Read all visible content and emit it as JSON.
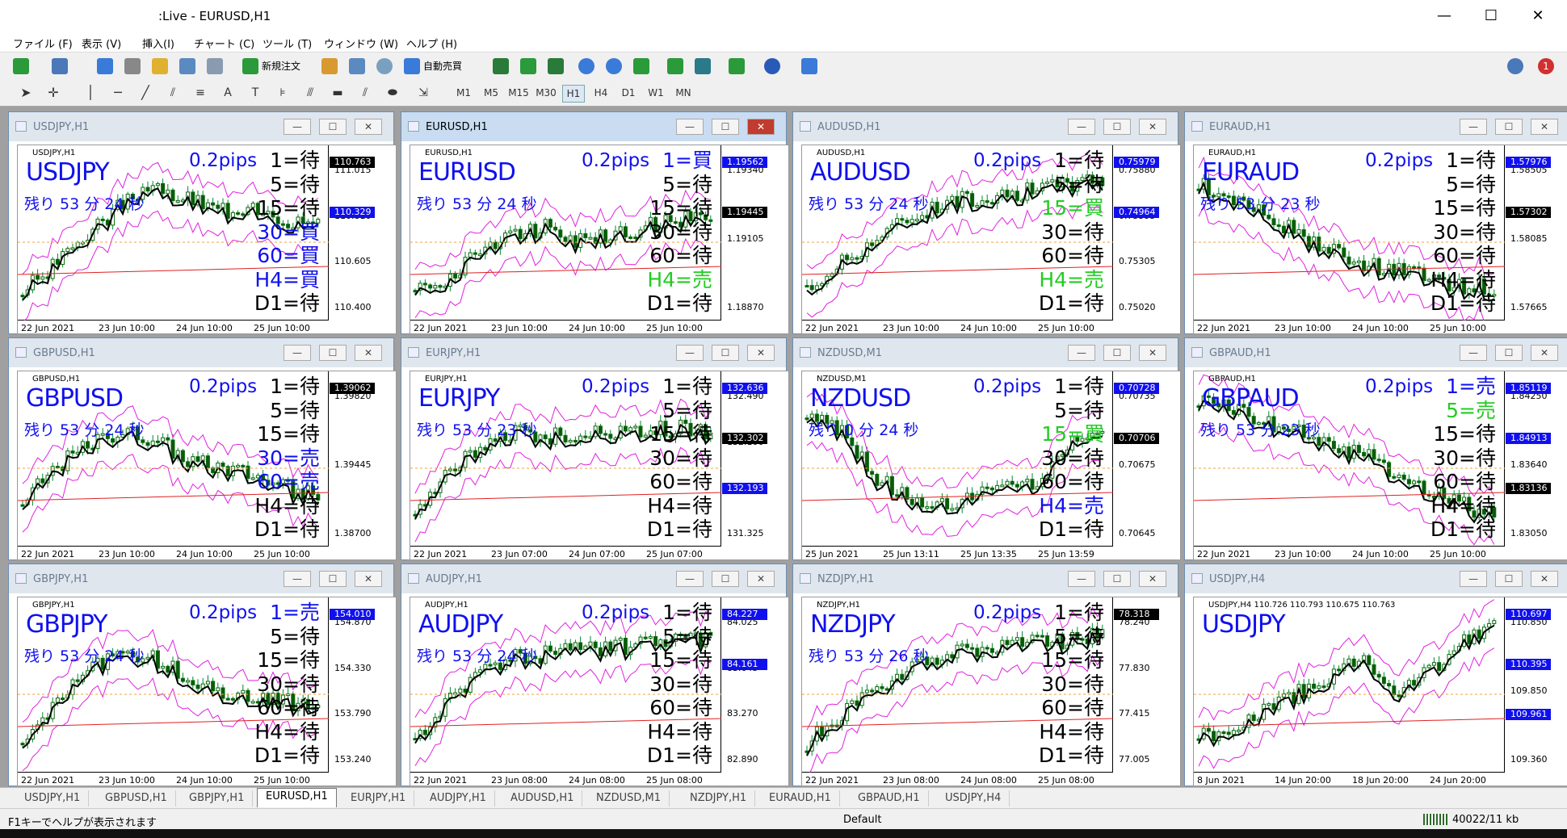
{
  "title": ":Live - EURUSD,H1",
  "menu": [
    "ファイル (F)",
    "表示 (V)",
    "挿入(I)",
    "チャート (C)",
    "ツール (T)",
    "ウィンドウ (W)",
    "ヘルプ (H)"
  ],
  "toolbar": {
    "new_order": "新規注文",
    "auto_trade": "自動売買"
  },
  "timeframes": [
    "M1",
    "M5",
    "M15",
    "M30",
    "H1",
    "H4",
    "D1",
    "W1",
    "MN"
  ],
  "notif_count": "1",
  "charts": [
    {
      "caption": "USDJPY,H1",
      "mini": "USDJPY,H1",
      "sym": "USDJPY",
      "pips": "0.2pips",
      "remain": "残り 53 分 24 秒",
      "sig": [
        "1=待",
        "5=待",
        "15=待",
        "30=買",
        "60=買",
        "H4=買",
        "D1=待"
      ],
      "sigc": [
        "k",
        "k",
        "k",
        "b",
        "b",
        "b",
        "k"
      ],
      "prices": [
        "111.015",
        "110.810",
        "110.605",
        "110.400"
      ],
      "tags": [
        {
          "t": "110.763",
          "c": "black"
        },
        {
          "t": "110.329",
          "c": "blue"
        }
      ],
      "xl": [
        "22 Jun 2021",
        "23 Jun 10:00",
        "24 Jun 10:00",
        "25 Jun 10:00"
      ],
      "trend": [
        0.1,
        0.3,
        0.5,
        0.7,
        0.8,
        0.75,
        0.65,
        0.7,
        0.6,
        0.55
      ]
    },
    {
      "caption": "EURUSD,H1",
      "mini": "EURUSD,H1",
      "sym": "EURUSD",
      "pips": "0.2pips",
      "remain": "残り 53 分 24 秒",
      "sig": [
        "1=買",
        "5=待",
        "15=待",
        "30=待",
        "60=待",
        "H4=売",
        "D1=待"
      ],
      "sigc": [
        "b",
        "k",
        "k",
        "k",
        "k",
        "g",
        "k"
      ],
      "prices": [
        "1.19340",
        "1.19105",
        "1.18870"
      ],
      "tags": [
        {
          "t": "1.19562",
          "c": "blue"
        },
        {
          "t": "1.19445",
          "c": "black"
        }
      ],
      "xl": [
        "22 Jun 2021",
        "23 Jun 10:00",
        "24 Jun 10:00",
        "25 Jun 10:00"
      ],
      "trend": [
        0.1,
        0.2,
        0.4,
        0.5,
        0.55,
        0.45,
        0.5,
        0.55,
        0.6,
        0.65
      ]
    },
    {
      "caption": "AUDUSD,H1",
      "mini": "AUDUSD,H1",
      "sym": "AUDUSD",
      "pips": "0.2pips",
      "remain": "残り 53 分 24 秒",
      "sig": [
        "1=待",
        "5=待",
        "15=買",
        "30=待",
        "60=待",
        "H4=売",
        "D1=待"
      ],
      "sigc": [
        "k",
        "k",
        "g",
        "k",
        "k",
        "g",
        "k"
      ],
      "prices": [
        "0.75880",
        "0.75595",
        "0.75305",
        "0.75020"
      ],
      "tags": [
        {
          "t": "0.75979",
          "c": "blue"
        },
        {
          "t": "0.74964",
          "c": "blue"
        }
      ],
      "xl": [
        "22 Jun 2021",
        "23 Jun 10:00",
        "24 Jun 10:00",
        "25 Jun 10:00"
      ],
      "trend": [
        0.1,
        0.3,
        0.45,
        0.6,
        0.7,
        0.75,
        0.78,
        0.8,
        0.85,
        0.88
      ]
    },
    {
      "caption": "EURAUD,H1",
      "mini": "EURAUD,H1",
      "sym": "EURAUD",
      "pips": "0.2pips",
      "remain": "残り 53 分 23 秒",
      "sig": [
        "1=待",
        "5=待",
        "15=待",
        "30=待",
        "60=待",
        "H4=待",
        "D1=待"
      ],
      "sigc": [
        "k",
        "k",
        "k",
        "k",
        "k",
        "k",
        "k"
      ],
      "prices": [
        "1.58505",
        "1.58085",
        "1.57665"
      ],
      "tags": [
        {
          "t": "1.57976",
          "c": "blue"
        },
        {
          "t": "1.57302",
          "c": "black"
        }
      ],
      "xl": [
        "22 Jun 2021",
        "23 Jun 10:00",
        "24 Jun 10:00",
        "25 Jun 10:00"
      ],
      "trend": [
        0.85,
        0.75,
        0.65,
        0.5,
        0.4,
        0.3,
        0.25,
        0.2,
        0.15,
        0.12
      ]
    },
    {
      "caption": "GBPUSD,H1",
      "mini": "GBPUSD,H1",
      "sym": "GBPUSD",
      "pips": "0.2pips",
      "remain": "残り 53 分 24 秒",
      "sig": [
        "1=待",
        "5=待",
        "15=待",
        "30=売",
        "60=売",
        "H4=待",
        "D1=待"
      ],
      "sigc": [
        "k",
        "k",
        "k",
        "b",
        "b",
        "k",
        "k"
      ],
      "prices": [
        "1.39820",
        "1.39445",
        "1.38700"
      ],
      "tags": [
        {
          "t": "1.39062",
          "c": "black"
        }
      ],
      "xl": [
        "22 Jun 2021",
        "23 Jun 10:00",
        "24 Jun 10:00",
        "25 Jun 10:00"
      ],
      "trend": [
        0.2,
        0.45,
        0.6,
        0.7,
        0.65,
        0.5,
        0.45,
        0.4,
        0.3,
        0.25
      ]
    },
    {
      "caption": "EURJPY,H1",
      "mini": "EURJPY,H1",
      "sym": "EURJPY",
      "pips": "0.2pips",
      "remain": "残り 53 分 23 秒",
      "sig": [
        "1=待",
        "5=待",
        "15=待",
        "30=待",
        "60=待",
        "H4=待",
        "D1=待"
      ],
      "sigc": [
        "k",
        "k",
        "k",
        "k",
        "k",
        "k",
        "k"
      ],
      "prices": [
        "132.490",
        "132.100",
        "131.715",
        "131.325"
      ],
      "tags": [
        {
          "t": "132.636",
          "c": "blue"
        },
        {
          "t": "132.302",
          "c": "black"
        },
        {
          "t": "132.193",
          "c": "blue"
        }
      ],
      "xl": [
        "22 Jun 2021",
        "23 Jun 07:00",
        "24 Jun 07:00",
        "25 Jun 07:00"
      ],
      "trend": [
        0.1,
        0.4,
        0.6,
        0.7,
        0.65,
        0.7,
        0.68,
        0.7,
        0.72,
        0.7
      ]
    },
    {
      "caption": "NZDUSD,M1",
      "mini": "NZDUSD,M1",
      "sym": "NZDUSD",
      "pips": "0.2pips",
      "remain": "残り 0 分 24 秒",
      "sig": [
        "1=待",
        "5=待",
        "15=買",
        "30=待",
        "60=待",
        "H4=売",
        "D1=待"
      ],
      "sigc": [
        "k",
        "k",
        "g",
        "k",
        "k",
        "b",
        "k"
      ],
      "prices": [
        "0.70735",
        "0.70675",
        "0.70645"
      ],
      "tags": [
        {
          "t": "0.70728",
          "c": "blue"
        },
        {
          "t": "0.70706",
          "c": "black"
        }
      ],
      "xl": [
        "25 Jun 2021",
        "25 Jun 13:11",
        "25 Jun 13:35",
        "25 Jun 13:59"
      ],
      "trend": [
        0.85,
        0.7,
        0.4,
        0.25,
        0.2,
        0.25,
        0.3,
        0.35,
        0.6,
        0.7
      ]
    },
    {
      "caption": "GBPAUD,H1",
      "mini": "GBPAUD,H1",
      "sym": "GBPAUD",
      "pips": "0.2pips",
      "remain": "残り 53 分 23 秒",
      "sig": [
        "1=売",
        "5=売",
        "15=待",
        "30=待",
        "60=待",
        "H4=待",
        "D1=待"
      ],
      "sigc": [
        "b",
        "g",
        "k",
        "k",
        "k",
        "k",
        "k"
      ],
      "prices": [
        "1.84250",
        "1.83640",
        "1.83050"
      ],
      "tags": [
        {
          "t": "1.85119",
          "c": "blue"
        },
        {
          "t": "1.84913",
          "c": "blue"
        },
        {
          "t": "1.83136",
          "c": "black"
        }
      ],
      "xl": [
        "22 Jun 2021",
        "23 Jun 10:00",
        "24 Jun 10:00",
        "25 Jun 10:00"
      ],
      "trend": [
        0.9,
        0.85,
        0.75,
        0.7,
        0.6,
        0.55,
        0.4,
        0.3,
        0.2,
        0.1
      ]
    },
    {
      "caption": "GBPJPY,H1",
      "mini": "GBPJPY,H1",
      "sym": "GBPJPY",
      "pips": "0.2pips",
      "remain": "残り 53 分 24 秒",
      "sig": [
        "1=売",
        "5=待",
        "15=待",
        "30=待",
        "60=待",
        "H4=待",
        "D1=待"
      ],
      "sigc": [
        "b",
        "k",
        "k",
        "k",
        "k",
        "k",
        "k"
      ],
      "prices": [
        "154.870",
        "154.330",
        "153.790",
        "153.240"
      ],
      "tags": [
        {
          "t": "154.010",
          "c": "blue"
        }
      ],
      "xl": [
        "22 Jun 2021",
        "23 Jun 10:00",
        "24 Jun 10:00",
        "25 Jun 10:00"
      ],
      "trend": [
        0.1,
        0.4,
        0.6,
        0.75,
        0.7,
        0.55,
        0.45,
        0.45,
        0.4,
        0.35
      ]
    },
    {
      "caption": "AUDJPY,H1",
      "mini": "AUDJPY,H1",
      "sym": "AUDJPY",
      "pips": "0.2pips",
      "remain": "残り 53 分 24 秒",
      "sig": [
        "1=待",
        "5=待",
        "15=待",
        "30=待",
        "60=待",
        "H4=待",
        "D1=待"
      ],
      "sigc": [
        "k",
        "k",
        "k",
        "k",
        "k",
        "k",
        "k"
      ],
      "prices": [
        "84.025",
        "83.645",
        "83.270",
        "82.890"
      ],
      "tags": [
        {
          "t": "84.227",
          "c": "blue"
        },
        {
          "t": "84.161",
          "c": "blue"
        }
      ],
      "xl": [
        "22 Jun 2021",
        "23 Jun 08:00",
        "24 Jun 08:00",
        "25 Jun 08:00"
      ],
      "trend": [
        0.1,
        0.4,
        0.6,
        0.7,
        0.72,
        0.75,
        0.77,
        0.78,
        0.8,
        0.82
      ]
    },
    {
      "caption": "NZDJPY,H1",
      "mini": "NZDJPY,H1",
      "sym": "NZDJPY",
      "pips": "0.2pips",
      "remain": "残り 53 分 26 秒",
      "sig": [
        "1=待",
        "5=待",
        "15=待",
        "30=待",
        "60=待",
        "H4=待",
        "D1=待"
      ],
      "sigc": [
        "k",
        "k",
        "k",
        "k",
        "k",
        "k",
        "k"
      ],
      "prices": [
        "78.240",
        "77.830",
        "77.415",
        "77.005"
      ],
      "tags": [
        {
          "t": "78.318",
          "c": "black"
        }
      ],
      "xl": [
        "22 Jun 2021",
        "23 Jun 08:00",
        "24 Jun 08:00",
        "25 Jun 08:00"
      ],
      "trend": [
        0.1,
        0.3,
        0.45,
        0.6,
        0.7,
        0.75,
        0.78,
        0.8,
        0.82,
        0.85
      ]
    },
    {
      "caption": "USDJPY,H4",
      "mini": "USDJPY,H4  110.726 110.793 110.675 110.763",
      "sym": "USDJPY",
      "pips": "",
      "remain": "",
      "sig": [],
      "sigc": [],
      "prices": [
        "110.850",
        "109.850",
        "109.360"
      ],
      "tags": [
        {
          "t": "110.697",
          "c": "blue"
        },
        {
          "t": "110.395",
          "c": "blue"
        },
        {
          "t": "109.961",
          "c": "blue"
        }
      ],
      "xl": [
        "8 Jun 2021",
        "14 Jun 20:00",
        "18 Jun 20:00",
        "24 Jun 20:00"
      ],
      "trend": [
        0.15,
        0.2,
        0.35,
        0.45,
        0.55,
        0.7,
        0.45,
        0.6,
        0.8,
        0.9
      ]
    }
  ],
  "tabs": [
    "USDJPY,H1",
    "GBPUSD,H1",
    "GBPJPY,H1",
    "EURUSD,H1",
    "EURJPY,H1",
    "AUDJPY,H1",
    "AUDUSD,H1",
    "NZDUSD,M1",
    "NZDJPY,H1",
    "EURAUD,H1",
    "GBPAUD,H1",
    "USDJPY,H4"
  ],
  "active_tab": "EURUSD,H1",
  "status": {
    "help": "F1キーでヘルプが表示されます",
    "profile": "Default",
    "traffic": "40022/11 kb"
  }
}
